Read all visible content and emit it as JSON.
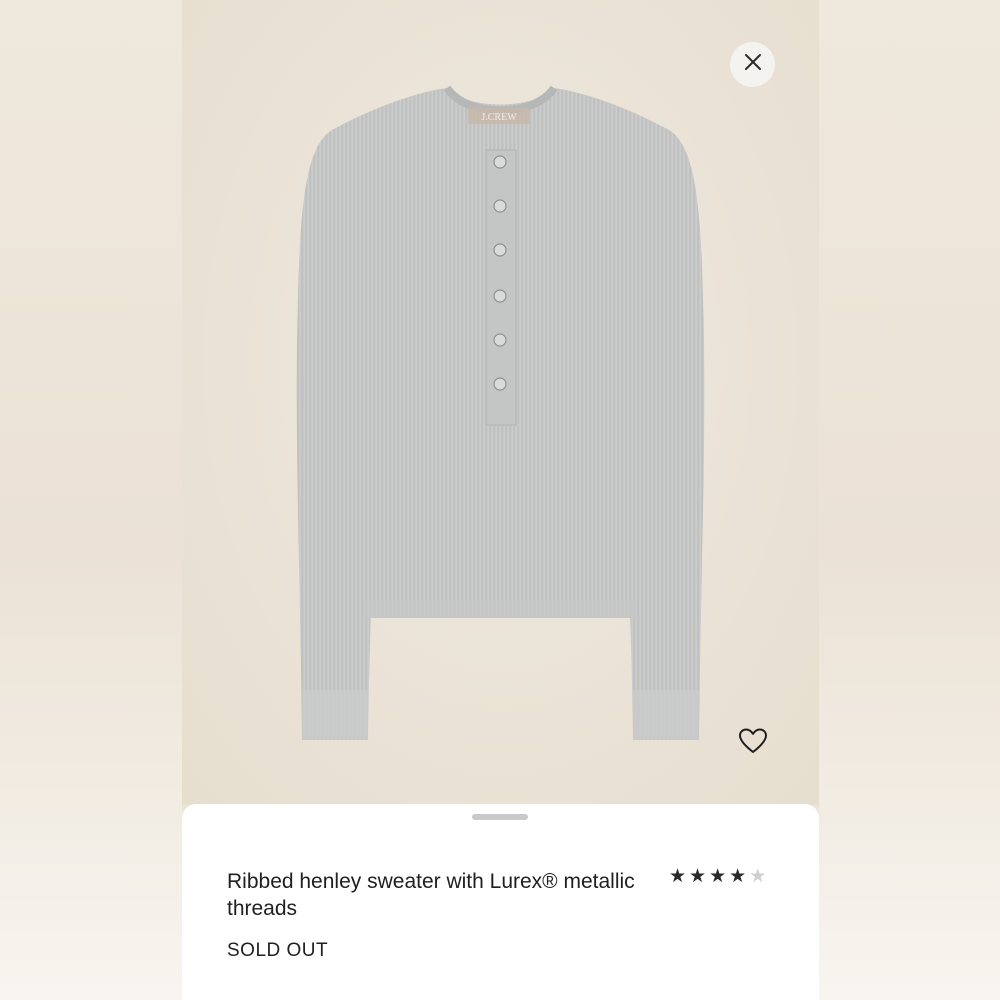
{
  "product": {
    "brand_tag": "J.CREW",
    "title": "Ribbed henley sweater with  Lurex® metallic threads",
    "status": "SOLD OUT",
    "rating": {
      "value": 4,
      "max": 5,
      "stars": [
        "★",
        "★",
        "★",
        "★",
        "★"
      ]
    }
  },
  "icons": {
    "close": "close-icon",
    "favorite": "heart-icon"
  },
  "colors": {
    "background": "#ebe4d8",
    "sweater": "#c8c9c9",
    "sheet": "#ffffff",
    "text": "#1f1f1f",
    "star_filled": "#2a2a2a",
    "star_empty": "#cfcfcf"
  }
}
